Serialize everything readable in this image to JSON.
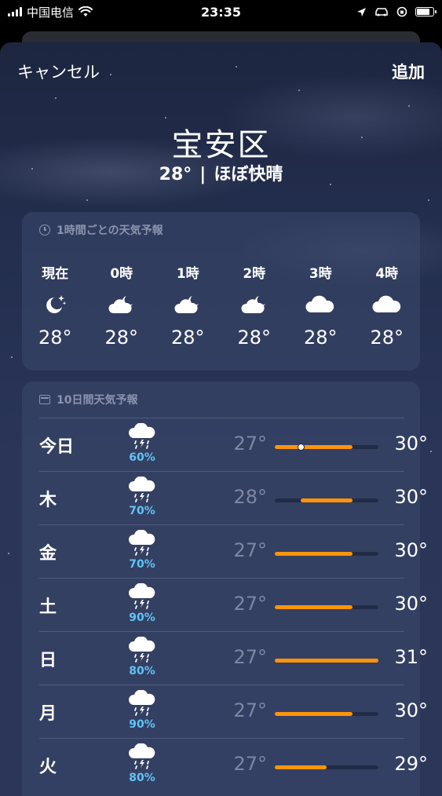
{
  "status_bar": {
    "carrier": "中国电信",
    "time": "23:35"
  },
  "nav": {
    "cancel_label": "キャンセル",
    "add_label": "追加"
  },
  "location": {
    "city": "宝安区",
    "temp": "28°",
    "condition": "ほぼ快晴"
  },
  "hourly": {
    "header": "1時間ごとの天気予報",
    "items": [
      {
        "label": "現在",
        "icon": "moon-stars-icon",
        "temp": "28°"
      },
      {
        "label": "0時",
        "icon": "cloud-moon-icon",
        "temp": "28°"
      },
      {
        "label": "1時",
        "icon": "cloud-moon-icon",
        "temp": "28°"
      },
      {
        "label": "2時",
        "icon": "cloud-moon-icon",
        "temp": "28°"
      },
      {
        "label": "3時",
        "icon": "cloud-icon",
        "temp": "28°"
      },
      {
        "label": "4時",
        "icon": "cloud-icon",
        "temp": "28°"
      }
    ]
  },
  "daily": {
    "header": "10日間天気予報",
    "range_min": 27,
    "range_max": 31,
    "current_temp": 28,
    "items": [
      {
        "day": "今日",
        "icon": "thunderstorm-rain-icon",
        "pop": "60%",
        "low": "27°",
        "high": "30°",
        "low_val": 27,
        "high_val": 30,
        "show_current": true
      },
      {
        "day": "木",
        "icon": "thunderstorm-rain-icon",
        "pop": "70%",
        "low": "28°",
        "high": "30°",
        "low_val": 28,
        "high_val": 30,
        "show_current": false
      },
      {
        "day": "金",
        "icon": "thunderstorm-rain-icon",
        "pop": "70%",
        "low": "27°",
        "high": "30°",
        "low_val": 27,
        "high_val": 30,
        "show_current": false
      },
      {
        "day": "土",
        "icon": "thunderstorm-rain-icon",
        "pop": "90%",
        "low": "27°",
        "high": "30°",
        "low_val": 27,
        "high_val": 30,
        "show_current": false
      },
      {
        "day": "日",
        "icon": "thunderstorm-rain-icon",
        "pop": "80%",
        "low": "27°",
        "high": "31°",
        "low_val": 27,
        "high_val": 31,
        "show_current": false
      },
      {
        "day": "月",
        "icon": "thunderstorm-rain-icon",
        "pop": "90%",
        "low": "27°",
        "high": "30°",
        "low_val": 27,
        "high_val": 30,
        "show_current": false
      },
      {
        "day": "火",
        "icon": "thunderstorm-rain-icon",
        "pop": "80%",
        "low": "27°",
        "high": "29°",
        "low_val": 27,
        "high_val": 29,
        "show_current": false
      }
    ]
  },
  "colors": {
    "accent_bar": "#ff9408",
    "precip": "#5fc4f7"
  }
}
